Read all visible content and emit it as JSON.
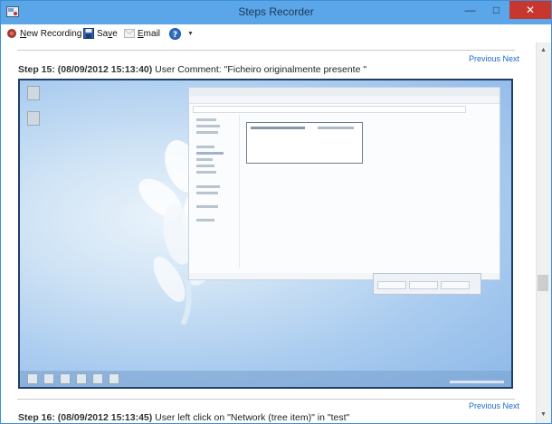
{
  "window": {
    "title": "Steps Recorder",
    "minimize_glyph": "—",
    "maximize_glyph": "□",
    "close_glyph": "✕"
  },
  "toolbar": {
    "new_recording_pre": "N",
    "new_recording_rest": "ew Recording",
    "save_pre": "Sa",
    "save_u": "v",
    "save_rest": "e",
    "email_pre": "",
    "email_u": "E",
    "email_rest": "mail",
    "help_glyph": "?",
    "dropdown_glyph": "▼"
  },
  "step15": {
    "nav_previous": "Previous",
    "nav_next": "Next",
    "label": "Step 15: (08/09/2012 15:13:40)",
    "text": " User Comment: \"Ficheiro originalmente presente \""
  },
  "step16": {
    "nav_previous": "Previous",
    "nav_next": "Next",
    "label": "Step 16: (08/09/2012 15:13:45)",
    "text": " User left click on \"Network (tree item)\" in \"test\""
  },
  "scrollbar": {
    "up_glyph": "▲",
    "down_glyph": "▼"
  },
  "icons": {
    "app": "steps-recorder-icon",
    "record": "record-icon",
    "save": "floppy-disk-icon",
    "email": "envelope-icon",
    "help": "help-icon",
    "dropdown": "chevron-down-icon"
  },
  "colors": {
    "titlebar": "#5aa6e8",
    "close": "#c7372f",
    "link": "#1b6ac9",
    "screenshot_border": "#1f3e6a"
  }
}
